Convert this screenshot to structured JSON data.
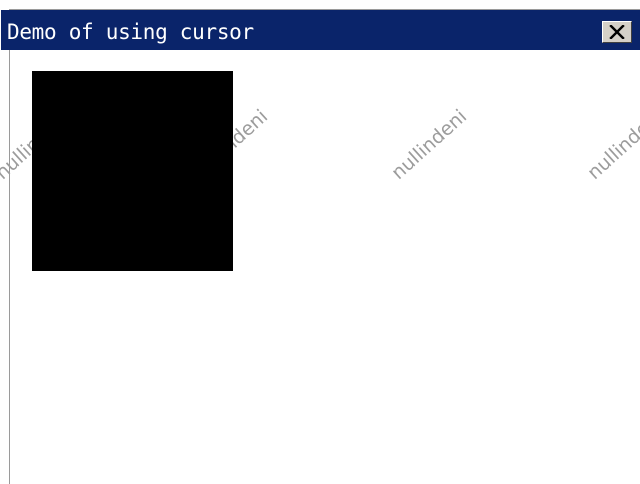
{
  "window": {
    "title": "Demo of using cursor",
    "close_icon": "close-icon"
  },
  "canvas": {
    "square_color": "#000000"
  },
  "watermark": {
    "text": "nullindeni"
  },
  "colors": {
    "titlebar": "#0a246a",
    "titlebar_text": "#ffffff",
    "button_face": "#d4d0c8",
    "background": "#ffffff"
  }
}
